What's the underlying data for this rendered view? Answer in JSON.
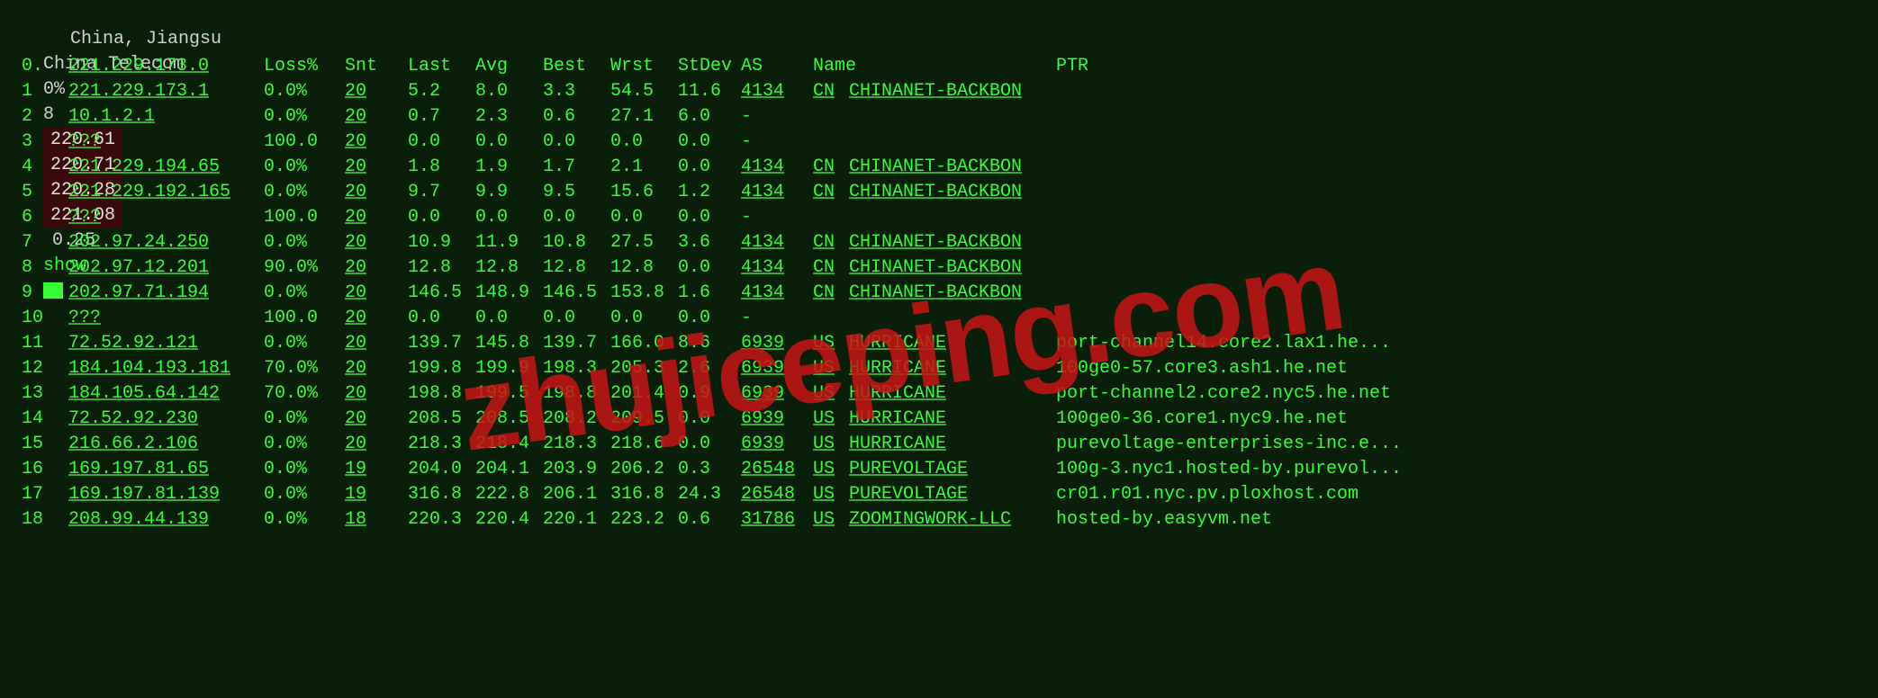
{
  "topbar": {
    "location": "China, Jiangsu",
    "provider": "China Telecom",
    "pct": "0%",
    "n": "8",
    "v1": "220.61",
    "v2": "220.71",
    "v3": "220.28",
    "v4": "221.08",
    "v5": "0.25",
    "show": "show"
  },
  "headers": {
    "hop": "0.",
    "ip": "221.229.173.0",
    "loss": "Loss%",
    "snt": "Snt",
    "last": "Last",
    "avg": "Avg",
    "best": "Best",
    "wrst": "Wrst",
    "stdev": "StDev",
    "asname": "AS Name",
    "ptr": "PTR"
  },
  "hops": [
    {
      "n": "1",
      "ip": "221.229.173.1",
      "loss": "0.0%",
      "snt": "20",
      "last": "5.2",
      "avg": "8.0",
      "best": "3.3",
      "wrst": "54.5",
      "stdev": "11.6",
      "asn": "4134",
      "cc": "CN",
      "asname": "CHINANET-BACKBON",
      "ptr": ""
    },
    {
      "n": "2",
      "ip": "10.1.2.1",
      "loss": "0.0%",
      "snt": "20",
      "last": "0.7",
      "avg": "2.3",
      "best": "0.6",
      "wrst": "27.1",
      "stdev": "6.0",
      "asn": "-",
      "cc": "",
      "asname": "",
      "ptr": ""
    },
    {
      "n": "3",
      "ip": "???",
      "loss": "100.0",
      "snt": "20",
      "last": "0.0",
      "avg": "0.0",
      "best": "0.0",
      "wrst": "0.0",
      "stdev": "0.0",
      "asn": "-",
      "cc": "",
      "asname": "",
      "ptr": ""
    },
    {
      "n": "4",
      "ip": "221.229.194.65",
      "loss": "0.0%",
      "snt": "20",
      "last": "1.8",
      "avg": "1.9",
      "best": "1.7",
      "wrst": "2.1",
      "stdev": "0.0",
      "asn": "4134",
      "cc": "CN",
      "asname": "CHINANET-BACKBON",
      "ptr": ""
    },
    {
      "n": "5",
      "ip": "221.229.192.165",
      "loss": "0.0%",
      "snt": "20",
      "last": "9.7",
      "avg": "9.9",
      "best": "9.5",
      "wrst": "15.6",
      "stdev": "1.2",
      "asn": "4134",
      "cc": "CN",
      "asname": "CHINANET-BACKBON",
      "ptr": ""
    },
    {
      "n": "6",
      "ip": "???",
      "loss": "100.0",
      "snt": "20",
      "last": "0.0",
      "avg": "0.0",
      "best": "0.0",
      "wrst": "0.0",
      "stdev": "0.0",
      "asn": "-",
      "cc": "",
      "asname": "",
      "ptr": ""
    },
    {
      "n": "7",
      "ip": "202.97.24.250",
      "loss": "0.0%",
      "snt": "20",
      "last": "10.9",
      "avg": "11.9",
      "best": "10.8",
      "wrst": "27.5",
      "stdev": "3.6",
      "asn": "4134",
      "cc": "CN",
      "asname": "CHINANET-BACKBON",
      "ptr": ""
    },
    {
      "n": "8",
      "ip": "202.97.12.201",
      "loss": "90.0%",
      "snt": "20",
      "last": "12.8",
      "avg": "12.8",
      "best": "12.8",
      "wrst": "12.8",
      "stdev": "0.0",
      "asn": "4134",
      "cc": "CN",
      "asname": "CHINANET-BACKBON",
      "ptr": ""
    },
    {
      "n": "9",
      "ip": "202.97.71.194",
      "loss": "0.0%",
      "snt": "20",
      "last": "146.5",
      "avg": "148.9",
      "best": "146.5",
      "wrst": "153.8",
      "stdev": "1.6",
      "asn": "4134",
      "cc": "CN",
      "asname": "CHINANET-BACKBON",
      "ptr": ""
    },
    {
      "n": "10",
      "ip": "???",
      "loss": "100.0",
      "snt": "20",
      "last": "0.0",
      "avg": "0.0",
      "best": "0.0",
      "wrst": "0.0",
      "stdev": "0.0",
      "asn": "-",
      "cc": "",
      "asname": "",
      "ptr": ""
    },
    {
      "n": "11",
      "ip": "72.52.92.121",
      "loss": "0.0%",
      "snt": "20",
      "last": "139.7",
      "avg": "145.8",
      "best": "139.7",
      "wrst": "166.0",
      "stdev": "8.6",
      "asn": "6939",
      "cc": "US",
      "asname": "HURRICANE",
      "ptr": "port-channel14.core2.lax1.he..."
    },
    {
      "n": "12",
      "ip": "184.104.193.181",
      "loss": "70.0%",
      "snt": "20",
      "last": "199.8",
      "avg": "199.9",
      "best": "198.3",
      "wrst": "205.3",
      "stdev": "2.6",
      "asn": "6939",
      "cc": "US",
      "asname": "HURRICANE",
      "ptr": "100ge0-57.core3.ash1.he.net"
    },
    {
      "n": "13",
      "ip": "184.105.64.142",
      "loss": "70.0%",
      "snt": "20",
      "last": "198.8",
      "avg": "199.5",
      "best": "198.8",
      "wrst": "201.4",
      "stdev": "0.9",
      "asn": "6939",
      "cc": "US",
      "asname": "HURRICANE",
      "ptr": "port-channel2.core2.nyc5.he.net"
    },
    {
      "n": "14",
      "ip": "72.52.92.230",
      "loss": "0.0%",
      "snt": "20",
      "last": "208.5",
      "avg": "208.5",
      "best": "208.2",
      "wrst": "209.5",
      "stdev": "0.0",
      "asn": "6939",
      "cc": "US",
      "asname": "HURRICANE",
      "ptr": "100ge0-36.core1.nyc9.he.net"
    },
    {
      "n": "15",
      "ip": "216.66.2.106",
      "loss": "0.0%",
      "snt": "20",
      "last": "218.3",
      "avg": "218.4",
      "best": "218.3",
      "wrst": "218.6",
      "stdev": "0.0",
      "asn": "6939",
      "cc": "US",
      "asname": "HURRICANE",
      "ptr": "purevoltage-enterprises-inc.e..."
    },
    {
      "n": "16",
      "ip": "169.197.81.65",
      "loss": "0.0%",
      "snt": "19",
      "last": "204.0",
      "avg": "204.1",
      "best": "203.9",
      "wrst": "206.2",
      "stdev": "0.3",
      "asn": "26548",
      "cc": "US",
      "asname": "PUREVOLTAGE",
      "ptr": "100g-3.nyc1.hosted-by.purevol..."
    },
    {
      "n": "17",
      "ip": "169.197.81.139",
      "loss": "0.0%",
      "snt": "19",
      "last": "316.8",
      "avg": "222.8",
      "best": "206.1",
      "wrst": "316.8",
      "stdev": "24.3",
      "asn": "26548",
      "cc": "US",
      "asname": "PUREVOLTAGE",
      "ptr": "cr01.r01.nyc.pv.ploxhost.com"
    },
    {
      "n": "18",
      "ip": "208.99.44.139",
      "loss": "0.0%",
      "snt": "18",
      "last": "220.3",
      "avg": "220.4",
      "best": "220.1",
      "wrst": "223.2",
      "stdev": "0.6",
      "asn": "31786",
      "cc": "US",
      "asname": "ZOOMINGWORK-LLC",
      "ptr": "hosted-by.easyvm.net"
    }
  ],
  "watermark": "zhujiceping.com"
}
